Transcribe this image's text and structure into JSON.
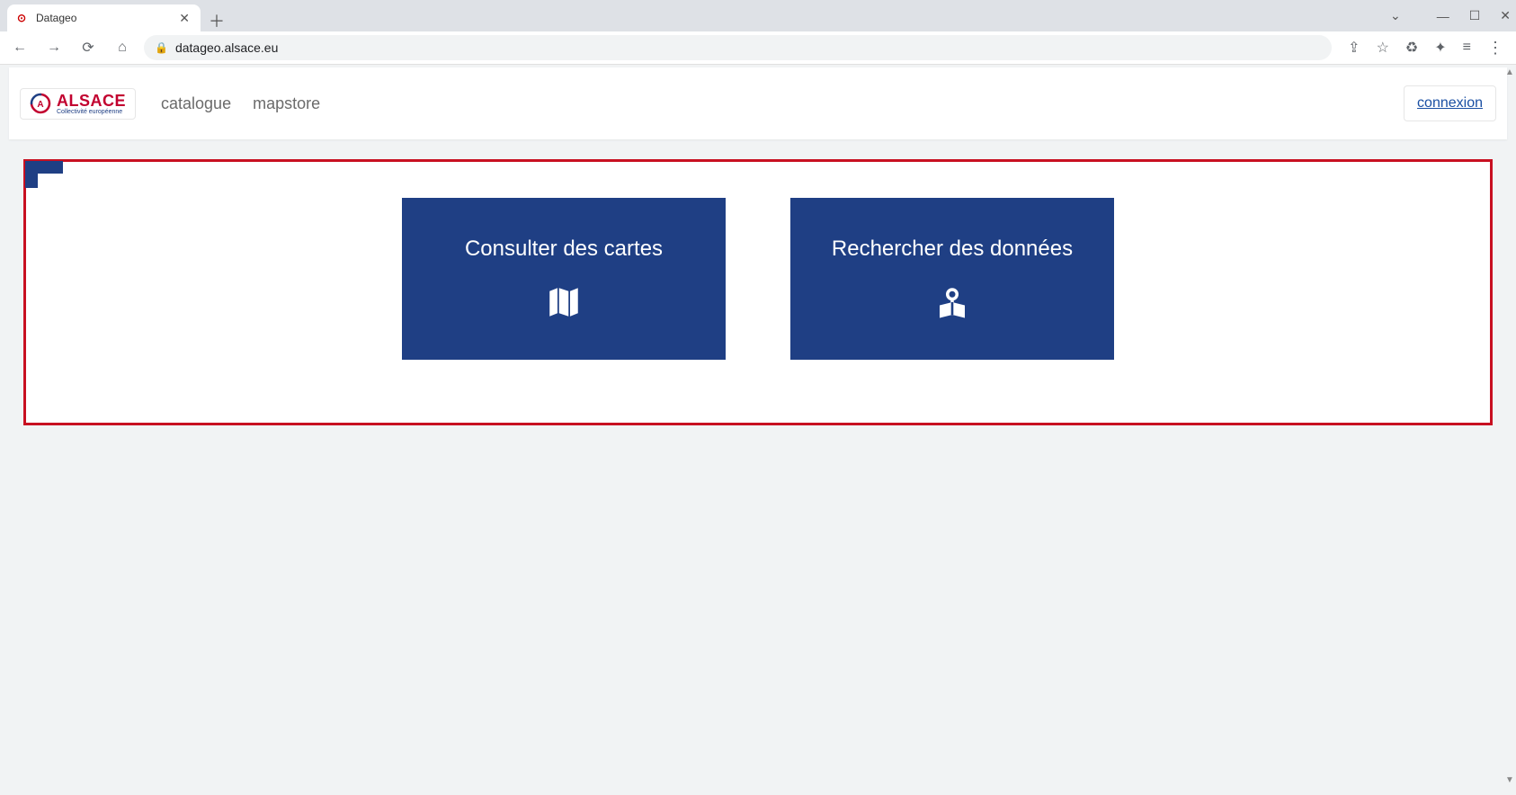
{
  "browser": {
    "tab_title": "Datageo",
    "url": "datageo.alsace.eu"
  },
  "header": {
    "logo": {
      "main": "ALSACE",
      "sub": "Collectivité européenne"
    },
    "nav": {
      "catalogue": "catalogue",
      "mapstore": "mapstore"
    },
    "login_label": "connexion"
  },
  "tiles": {
    "consult": "Consulter des cartes",
    "search": "Rechercher des données"
  }
}
